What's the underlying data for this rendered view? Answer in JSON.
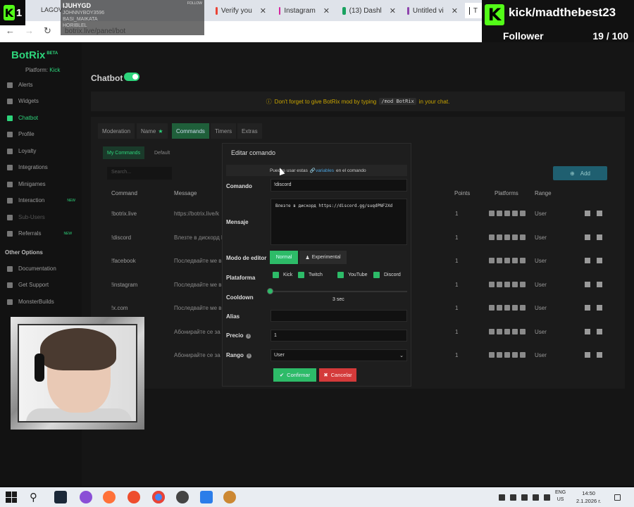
{
  "browser": {
    "tabs": [
      {
        "label": "LAGOV",
        "icon": "chrome-tab-icon",
        "color": "#888888"
      },
      {
        "label": "Verify you",
        "icon": "gmail-icon",
        "color": "#ea4335"
      },
      {
        "label": "Instagram",
        "icon": "instagram-icon",
        "color": "#d6249f"
      },
      {
        "label": "(13) Dashl",
        "icon": "dashboard-icon",
        "color": "#1aa260"
      },
      {
        "label": "Untitled vi",
        "icon": "video-icon",
        "color": "#8e44ad"
      },
      {
        "label": "T",
        "icon": "github-icon",
        "color": "#222222"
      }
    ],
    "url": "botrix.live/panel/bot"
  },
  "overlay_chat": {
    "badge": "1",
    "rows": [
      "IJUHYGD",
      "JOHNNYBOY3596",
      "BASI_MAIKATA",
      "HORIBLEL"
    ],
    "tag": "FOLLOW"
  },
  "overlay_follower": {
    "channel": "kick/madthebest23",
    "label": "Follower",
    "count": "19 / 100",
    "progress": 0.19,
    "accent": "#53fc18"
  },
  "sidebar": {
    "logo": "BotRix",
    "logo_tag": "BETA",
    "platform_label": "Platform:",
    "platform_value": "Kick",
    "items": [
      {
        "label": "Alerts",
        "state": "normal"
      },
      {
        "label": "Widgets",
        "state": "normal"
      },
      {
        "label": "Chatbot",
        "state": "active"
      },
      {
        "label": "Profile",
        "state": "normal"
      },
      {
        "label": "Loyalty",
        "state": "normal"
      },
      {
        "label": "Integrations",
        "state": "normal"
      },
      {
        "label": "Minigames",
        "state": "normal"
      },
      {
        "label": "Interaction",
        "state": "new",
        "tag": "NEW"
      },
      {
        "label": "Sub-Users",
        "state": "dim"
      },
      {
        "label": "Referrals",
        "state": "new",
        "tag": "NEW"
      }
    ],
    "other_options": "Other Options",
    "other_items": [
      "Documentation",
      "Get Support",
      "MonsterBuilds"
    ]
  },
  "main": {
    "title": "Chatbot",
    "notice_pre": "Don't forget to give BotRix mod by typing",
    "notice_code": "/mod BotRix",
    "notice_post": "in your chat.",
    "tabs": [
      "Moderation",
      "Name",
      "Commands",
      "Timers",
      "Extras"
    ],
    "subtabs": [
      "My Commands",
      "Default"
    ],
    "search_placeholder": "Search...",
    "add_label": "Add",
    "columns": [
      "Command",
      "Message",
      "Points",
      "Platforms",
      "Range"
    ],
    "rows": [
      {
        "command": "!botrix.live",
        "message": "https://botrix.live/k",
        "points": "1",
        "range": "User"
      },
      {
        "command": "!discord",
        "message": "Влезте в дискорд htt",
        "points": "1",
        "range": "User"
      },
      {
        "command": "!facebook",
        "message": "Последвайте ме в fa",
        "points": "1",
        "range": "User"
      },
      {
        "command": "!instagram",
        "message": "Последвайте ме в in",
        "points": "1",
        "range": "User"
      },
      {
        "command": "!x.com",
        "message": "Последвайте ме в x.",
        "points": "1",
        "range": "User"
      },
      {
        "command": "",
        "message": "Абонирайте се за ка",
        "points": "1",
        "range": "User"
      },
      {
        "command": "",
        "message": "Абонирайте се за ка",
        "points": "1",
        "range": "User"
      }
    ]
  },
  "modal": {
    "title": "Editar comando",
    "hint_pre": "Puedes usar estas",
    "hint_link": "variables",
    "hint_post": "en el comando",
    "labels": {
      "command": "Comando",
      "message": "Mensaje",
      "editor_mode": "Modo de editor",
      "platform": "Plataforma",
      "cooldown": "Cooldown",
      "alias": "Alias",
      "price": "Precio",
      "range": "Rango"
    },
    "command_value": "!discord",
    "message_value": "Влезте в  дискорд https://discord.gg/suqdPNF2Xd",
    "editor_normal": "Normal",
    "editor_experimental": "Experimental",
    "platforms": [
      "Kick",
      "Twitch",
      "YouTube",
      "Discord"
    ],
    "cooldown_value": "3 sec",
    "alias_value": "",
    "price_value": "1",
    "range_value": "User",
    "confirm": "Confirmar",
    "cancel": "Cancelar"
  },
  "taskbar": {
    "lang_line1": "ENG",
    "lang_line2": "US",
    "time": "14:50",
    "date": "2.1.2026 г."
  }
}
